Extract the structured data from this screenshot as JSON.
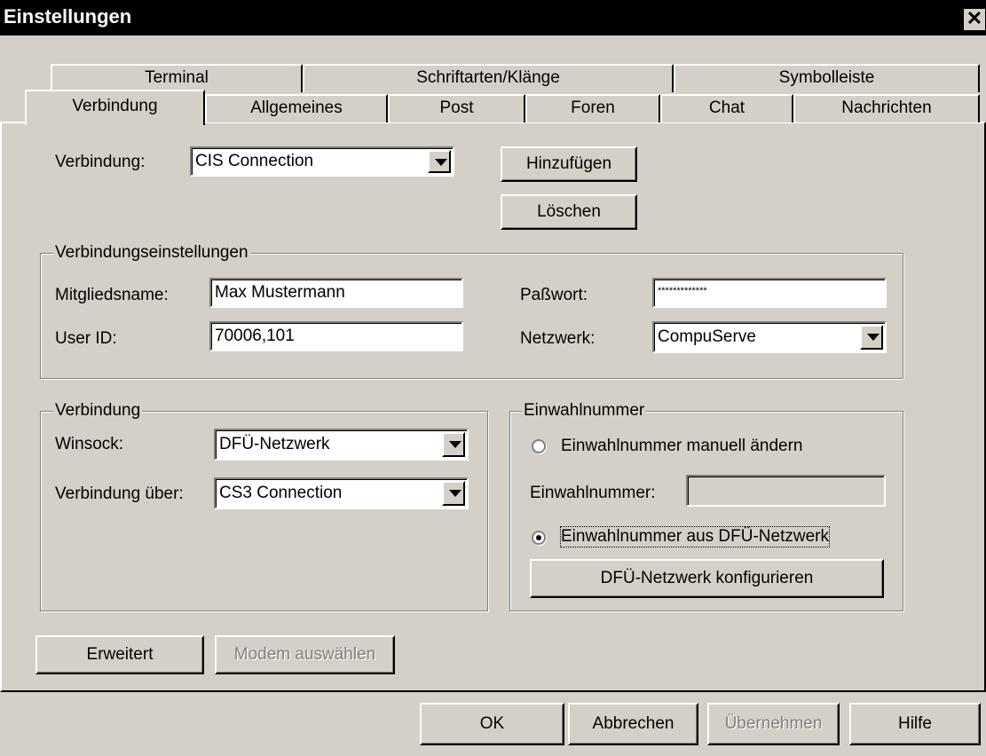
{
  "window": {
    "title": "Einstellungen",
    "close_label": "✕"
  },
  "tabs_back": [
    "Terminal",
    "Schriftarten/Klänge",
    "Symbolleiste"
  ],
  "tabs_front": [
    "Verbindung",
    "Allgemeines",
    "Post",
    "Foren",
    "Chat",
    "Nachrichten"
  ],
  "active_tab": "Verbindung",
  "connection": {
    "label": "Verbindung:",
    "value": "CIS Connection",
    "add_button": "Hinzufügen",
    "delete_button": "Löschen"
  },
  "settings_group": {
    "title": "Verbindungseinstellungen",
    "member_label": "Mitgliedsname:",
    "member_value": "Max Mustermann",
    "userid_label": "User ID:",
    "userid_value": "70006,101",
    "password_label": "Paßwort:",
    "password_value": "*************",
    "network_label": "Netzwerk:",
    "network_value": "CompuServe"
  },
  "conn_group": {
    "title": "Verbindung",
    "winsock_label": "Winsock:",
    "winsock_value": "DFÜ-Netzwerk",
    "via_label": "Verbindung über:",
    "via_value": "CS3 Connection"
  },
  "dial_group": {
    "title": "Einwahlnummer",
    "radio_manual": "Einwahlnummer manuell ändern",
    "number_label": "Einwahlnummer:",
    "number_value": "",
    "radio_dun": "Einwahlnummer aus DFÜ-Netzwerk",
    "configure_button": "DFÜ-Netzwerk konfigurieren",
    "selected": "dun"
  },
  "bottom": {
    "advanced_button": "Erweitert",
    "modem_button": "Modem auswählen"
  },
  "footer": {
    "ok": "OK",
    "cancel": "Abbrechen",
    "apply": "Übernehmen",
    "help": "Hilfe"
  },
  "colors": {
    "face": "#d4d0c8",
    "titlebar": "#000000",
    "disabled_text": "#808080"
  }
}
